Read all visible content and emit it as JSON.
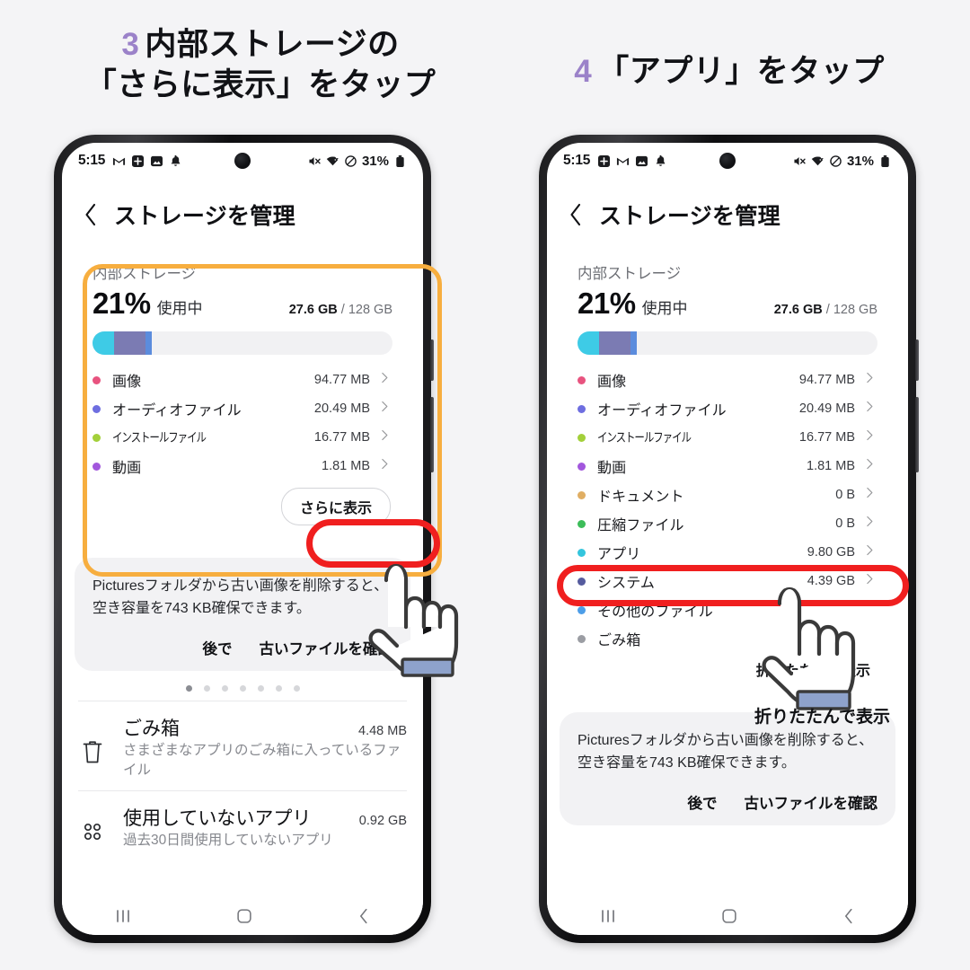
{
  "captions": {
    "left": {
      "num": "3",
      "line1": "内部ストレージの",
      "line2": "「さらに表示」をタップ"
    },
    "right": {
      "num": "4",
      "line1": "「アプリ」をタップ"
    },
    "accent": "#9b82c9"
  },
  "status_bar": {
    "time": "5:15",
    "battery": "31%",
    "left_icons": [
      "gmail-icon",
      "plus-box-icon",
      "photos-icon",
      "bell-icon"
    ],
    "right_icons": [
      "mute-icon",
      "wifi-icon",
      "do-not-disturb-icon",
      "battery-icon"
    ]
  },
  "header": {
    "title": "ストレージを管理",
    "back": "back-arrow-icon"
  },
  "storage": {
    "section_label": "内部ストレージ",
    "percent": "21%",
    "used_suffix": "使用中",
    "used": "27.6 GB",
    "separator": "/",
    "total": "128 GB",
    "bar_segments": [
      {
        "name": "cyan",
        "color": "#3ecbe6",
        "width_pct": 7.2
      },
      {
        "name": "purple",
        "color": "#7b7bb3",
        "width_pct": 10.5
      },
      {
        "name": "blue",
        "color": "#5b8cdd",
        "width_pct": 2.0
      }
    ],
    "items_collapsed": [
      {
        "label": "画像",
        "size": "94.77 MB",
        "color": "#e8537f",
        "small": false
      },
      {
        "label": "オーディオファイル",
        "size": "20.49 MB",
        "color": "#6e6ee0",
        "small": false
      },
      {
        "label": "インストールファイル",
        "size": "16.77 MB",
        "color": "#a3d03a",
        "small": true
      },
      {
        "label": "動画",
        "size": "1.81 MB",
        "color": "#a257dd",
        "small": false
      }
    ],
    "items_expanded": [
      {
        "label": "画像",
        "size": "94.77 MB",
        "color": "#e8537f",
        "small": false
      },
      {
        "label": "オーディオファイル",
        "size": "20.49 MB",
        "color": "#6e6ee0",
        "small": false
      },
      {
        "label": "インストールファイル",
        "size": "16.77 MB",
        "color": "#a3d03a",
        "small": true
      },
      {
        "label": "動画",
        "size": "1.81 MB",
        "color": "#a257dd",
        "small": false
      },
      {
        "label": "ドキュメント",
        "size": "0 B",
        "color": "#e0ae63",
        "small": false
      },
      {
        "label": "圧縮ファイル",
        "size": "0 B",
        "color": "#3dbd5a",
        "small": false
      },
      {
        "label": "アプリ",
        "size": "9.80 GB",
        "color": "#34c5dd",
        "small": false
      },
      {
        "label": "システム",
        "size": "4.39 GB",
        "color": "#555b9e",
        "small": false
      },
      {
        "label": "その他のファイル",
        "size": "",
        "color": "#4d9ee8",
        "small": false
      },
      {
        "label": "ごみ箱",
        "size": "",
        "color": "#9b9da3",
        "small": false
      }
    ],
    "more_button": "さらに表示",
    "collapse_button": "折りたたんで表示"
  },
  "tip": {
    "text": "Picturesフォルダから古い画像を削除すると、空き容量を743 KB確保できます。",
    "later": "後で",
    "confirm": "古いファイルを確認",
    "page_dots_total": 7,
    "page_dots_active": 1
  },
  "bottom_rows": [
    {
      "icon": "trash-icon",
      "title": "ごみ箱",
      "size": "4.48 MB",
      "sub": "さまざまなアプリのごみ箱に入っているファイル"
    },
    {
      "icon": "apps-grid-icon",
      "title": "使用していないアプリ",
      "size": "0.92 GB",
      "sub": "過去30日間使用していないアプリ"
    }
  ],
  "navbar": {
    "recents": "recents-icon",
    "home": "home-icon",
    "back": "back-icon"
  },
  "annotations": {
    "orange_box_color": "#f7ae3f",
    "red_pill_color": "#f01f1f",
    "hand_label_right": "折りたたんで表示"
  }
}
